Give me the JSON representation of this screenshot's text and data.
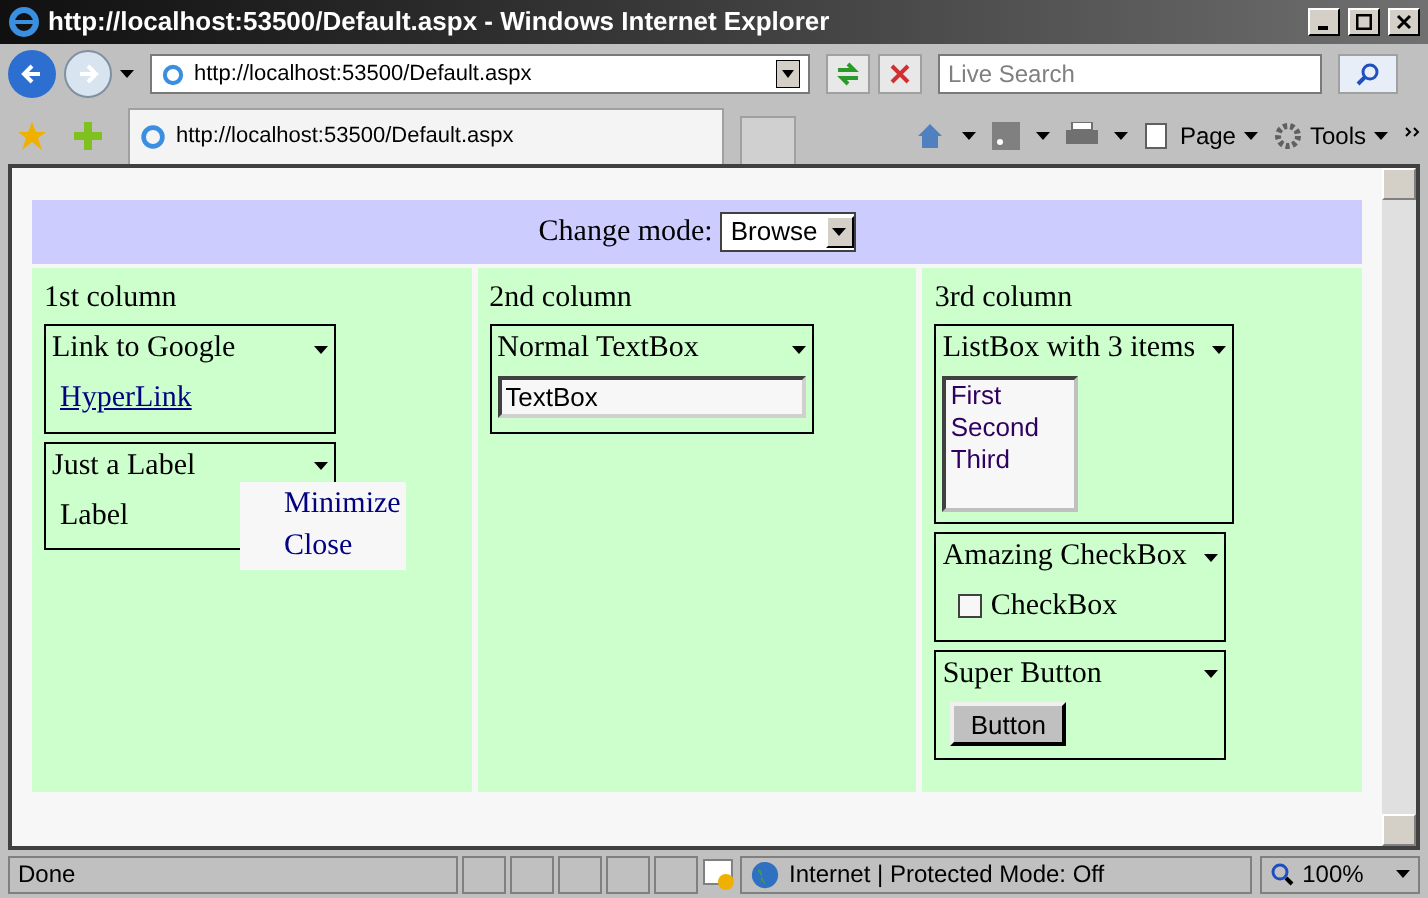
{
  "window": {
    "title": "http://localhost:53500/Default.aspx - Windows Internet Explorer"
  },
  "address": "http://localhost:53500/Default.aspx",
  "search": {
    "placeholder": "Live Search"
  },
  "tab": {
    "title": "http://localhost:53500/Default.aspx"
  },
  "command_bar": [
    "Page",
    "Tools"
  ],
  "mode": {
    "label": "Change mode:",
    "value": "Browse"
  },
  "columns": [
    {
      "title": "1st column",
      "parts": [
        {
          "title": "Link to Google",
          "kind": "link",
          "text": "HyperLink"
        },
        {
          "title": "Just a Label",
          "kind": "label",
          "text": "Label"
        }
      ]
    },
    {
      "title": "2nd column",
      "parts": [
        {
          "title": "Normal TextBox",
          "kind": "textbox",
          "text": "TextBox"
        }
      ]
    },
    {
      "title": "3rd column",
      "parts": [
        {
          "title": "ListBox with 3 items",
          "kind": "listbox",
          "items": [
            "First",
            "Second",
            "Third"
          ]
        },
        {
          "title": "Amazing CheckBox",
          "kind": "checkbox",
          "text": "CheckBox",
          "checked": false
        },
        {
          "title": "Super Button",
          "kind": "button",
          "text": "Button"
        }
      ]
    }
  ],
  "menu": [
    "Minimize",
    "Close"
  ],
  "status_bar": {
    "text": "Done",
    "zone": "Internet | Protected Mode: Off",
    "zoom": "100%"
  }
}
